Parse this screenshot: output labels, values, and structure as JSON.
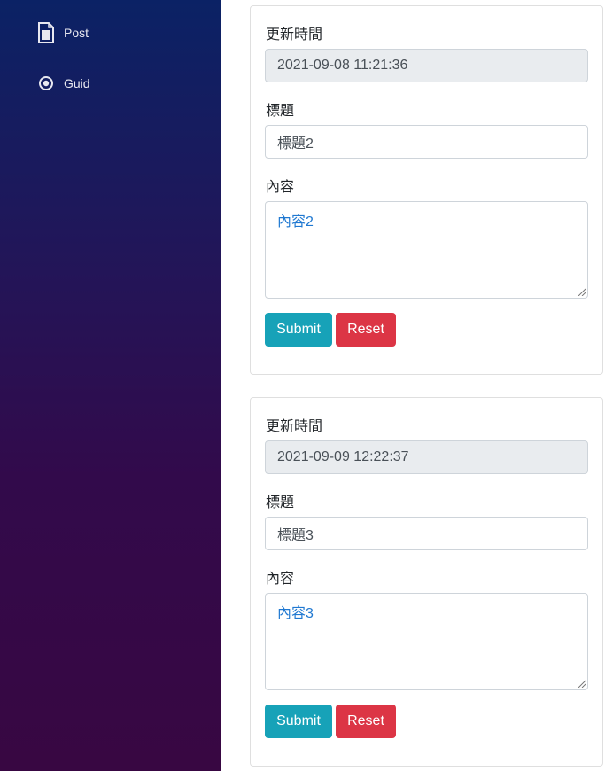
{
  "sidebar": {
    "items": [
      {
        "label": "Post",
        "icon": "document-icon"
      },
      {
        "label": "Guid",
        "icon": "radio-circle-icon"
      }
    ]
  },
  "forms": [
    {
      "updated_label": "更新時間",
      "updated_value": "2021-09-08 11:21:36",
      "title_label": "標題",
      "title_value": "標題2",
      "content_label": "內容",
      "content_value": "內容2",
      "submit_label": "Submit",
      "reset_label": "Reset"
    },
    {
      "updated_label": "更新時間",
      "updated_value": "2021-09-09 12:22:37",
      "title_label": "標題",
      "title_value": "標題3",
      "content_label": "內容",
      "content_value": "內容3",
      "submit_label": "Submit",
      "reset_label": "Reset"
    }
  ],
  "colors": {
    "submit": "#17a2b8",
    "reset": "#dc3545",
    "sidebar_top": "#0b2265",
    "sidebar_bottom": "#380742",
    "content_text": "#1f78d1"
  }
}
